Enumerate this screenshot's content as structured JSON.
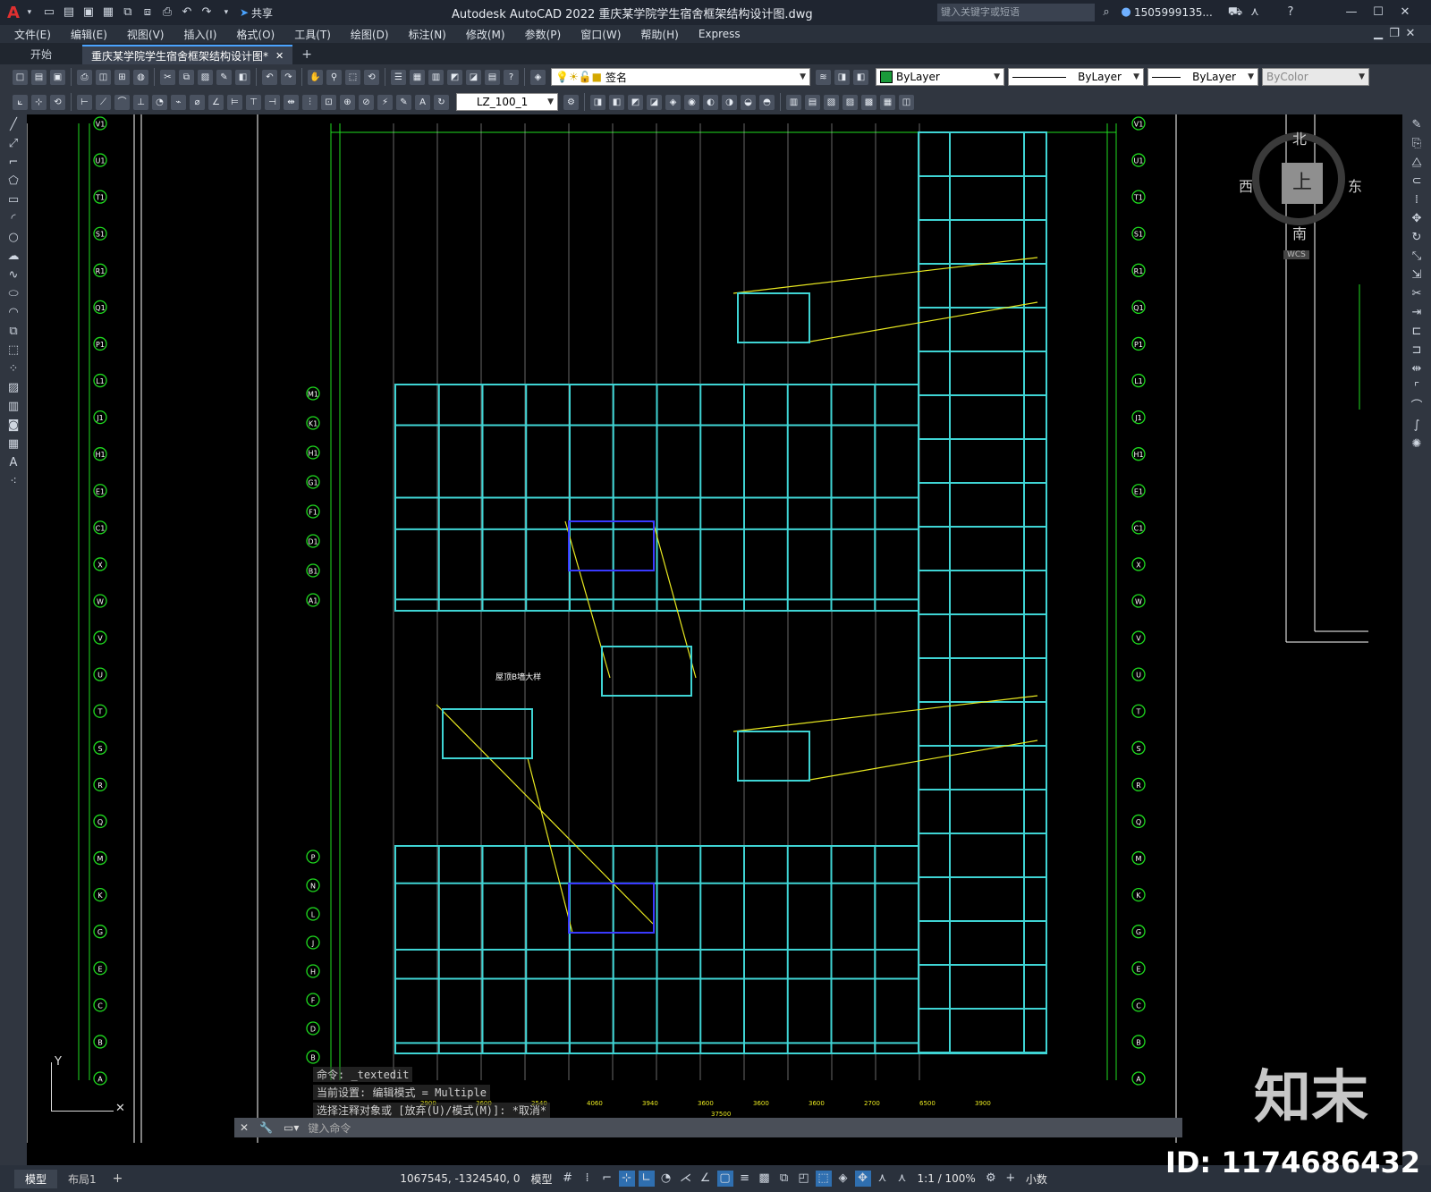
{
  "app": {
    "logo": "A",
    "share_label": "共享",
    "title": "Autodesk AutoCAD 2022    重庆某学院学生宿舍框架结构设计图.dwg",
    "search_placeholder": "键入关键字或短语",
    "user": "1505999135...",
    "colors": {
      "accent": "#1e90ff",
      "bg_dark": "#1f2530",
      "toolbar": "#303640"
    }
  },
  "menu": {
    "items": [
      "文件(E)",
      "编辑(E)",
      "视图(V)",
      "插入(I)",
      "格式(O)",
      "工具(T)",
      "绘图(D)",
      "标注(N)",
      "修改(M)",
      "参数(P)",
      "窗口(W)",
      "帮助(H)",
      "Express"
    ]
  },
  "tabs": {
    "start": "开始",
    "active": "重庆某学院学生宿舍框架结构设计图*"
  },
  "toolbar": {
    "layer": "签名",
    "color": "ByLayer",
    "linetype": "ByLayer",
    "lineweight": "ByLayer",
    "plotstyle": "ByColor",
    "dimstyle": "LZ_100_1"
  },
  "viewcube": {
    "north": "北",
    "south": "南",
    "east": "东",
    "west": "西",
    "top": "上",
    "wcs": "WCS"
  },
  "axis_labels_left": [
    "V1",
    "U1",
    "T1",
    "S1",
    "R1",
    "Q1",
    "P1",
    "L1",
    "J1",
    "H1",
    "E1",
    "C1",
    "X",
    "W",
    "V",
    "U",
    "T",
    "S",
    "R",
    "Q",
    "M",
    "K",
    "G",
    "E",
    "C",
    "B",
    "A"
  ],
  "plan_grid_labels": [
    "M1",
    "K1",
    "H1",
    "G1",
    "F1",
    "D1",
    "B1",
    "A1",
    "P",
    "N",
    "L",
    "J",
    "H",
    "F",
    "D",
    "B"
  ],
  "dim_bottom": [
    "2900",
    "3600",
    "2540",
    "4060",
    "3940",
    "3600",
    "3600",
    "3600",
    "2700",
    "6500",
    "3900"
  ],
  "dim_total": "37500",
  "detail_title": "屋顶B墙大样",
  "commands": [
    "命令: _textedit",
    "当前设置: 编辑模式 = Multiple",
    "选择注释对象或 [放弃(U)/模式(M)]: *取消*"
  ],
  "command_placeholder": "键入命令",
  "layout_tabs": [
    "模型",
    "布局1"
  ],
  "status": {
    "coords": "1067545, -1324540, 0",
    "model": "模型",
    "scale": "1:1 / 100%",
    "units": "小数"
  },
  "watermark": {
    "logo": "知末",
    "id": "ID: 1174686432"
  }
}
